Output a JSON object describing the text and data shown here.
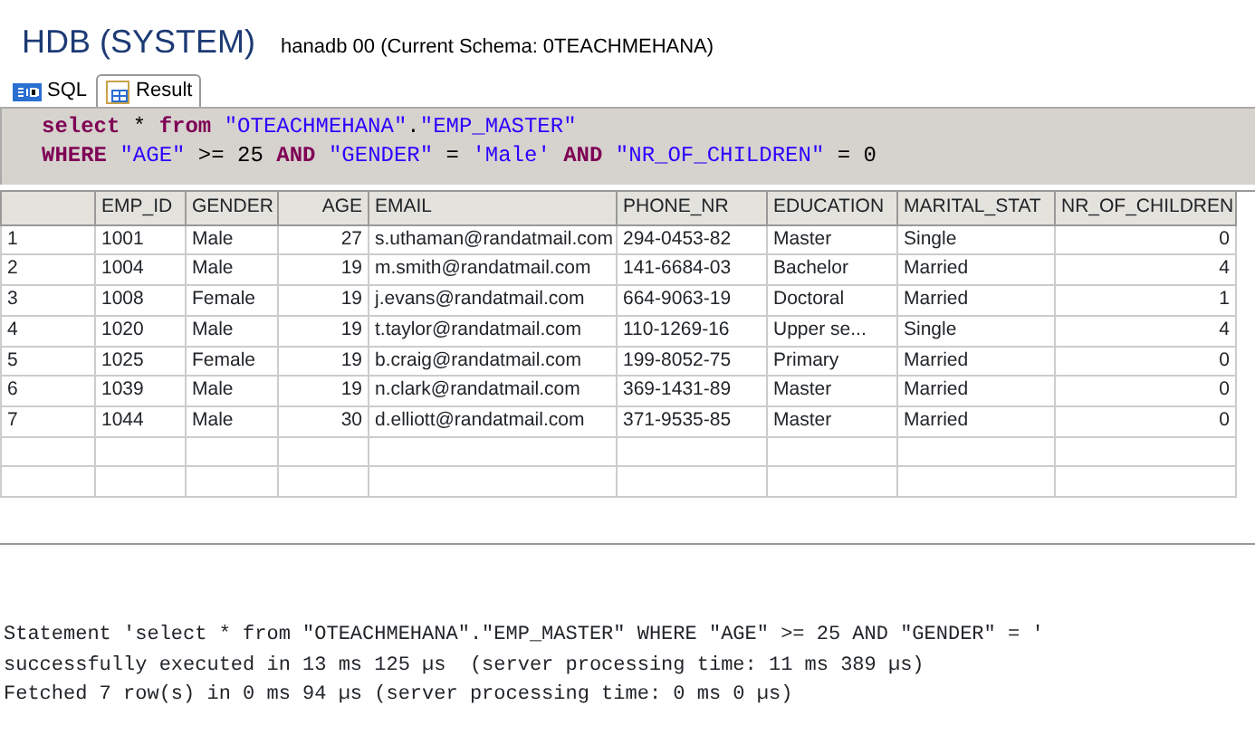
{
  "header": {
    "title": "HDB (SYSTEM)",
    "subtitle": "hanadb 00 (Current Schema: 0TEACHMEHANA)"
  },
  "tabs": [
    {
      "label": "SQL",
      "selected": false
    },
    {
      "label": "Result",
      "selected": true
    }
  ],
  "sql_lines": [
    [
      {
        "kind": "keyword",
        "text": "select"
      },
      {
        "kind": "plain",
        "text": " * "
      },
      {
        "kind": "keyword",
        "text": "from"
      },
      {
        "kind": "ident",
        "text": " \"OTEACHMEHANA\""
      },
      {
        "kind": "plain",
        "text": "."
      },
      {
        "kind": "ident",
        "text": "\"EMP_MASTER\""
      }
    ],
    [
      {
        "kind": "keyword",
        "text": "WHERE"
      },
      {
        "kind": "ident",
        "text": " \"AGE\""
      },
      {
        "kind": "plain",
        "text": " >= 25 "
      },
      {
        "kind": "keyword",
        "text": "AND"
      },
      {
        "kind": "ident",
        "text": " \"GENDER\""
      },
      {
        "kind": "plain",
        "text": " = "
      },
      {
        "kind": "ident",
        "text": "'Male' "
      },
      {
        "kind": "keyword",
        "text": "AND"
      },
      {
        "kind": "ident",
        "text": " \"NR_OF_CHILDREN\""
      },
      {
        "kind": "plain",
        "text": " = 0"
      }
    ]
  ],
  "table": {
    "columns": [
      "",
      "EMP_ID",
      "GENDER",
      "AGE",
      "EMAIL",
      "PHONE_NR",
      "EDUCATION",
      "MARITAL_STAT",
      "NR_OF_CHILDREN"
    ],
    "rows": [
      [
        "1",
        "1001",
        "Male",
        "27",
        "s.uthaman@randatmail.com",
        "294-0453-82",
        "Master",
        "Single",
        "0"
      ],
      [
        "2",
        "1004",
        "Male",
        "19",
        "m.smith@randatmail.com",
        "141-6684-03",
        "Bachelor",
        "Married",
        "4"
      ],
      [
        "3",
        "1008",
        "Female",
        "19",
        "j.evans@randatmail.com",
        "664-9063-19",
        "Doctoral",
        "Married",
        "1"
      ],
      [
        "4",
        "1020",
        "Male",
        "19",
        "t.taylor@randatmail.com",
        "110-1269-16",
        "Upper se...",
        "Single",
        "4"
      ],
      [
        "5",
        "1025",
        "Female",
        "19",
        "b.craig@randatmail.com",
        "199-8052-75",
        "Primary",
        "Married",
        "0"
      ],
      [
        "6",
        "1039",
        "Male",
        "19",
        "n.clark@randatmail.com",
        "369-1431-89",
        "Master",
        "Married",
        "0"
      ],
      [
        "7",
        "1044",
        "Male",
        "30",
        "d.elliott@randatmail.com",
        "371-9535-85",
        "Master",
        "Married",
        "0"
      ]
    ]
  },
  "log": [
    "Statement 'select * from \"OTEACHMEHANA\".\"EMP_MASTER\" WHERE \"AGE\" >= 25 AND \"GENDER\" = '",
    "successfully executed in 13 ms 125 µs  (server processing time: 11 ms 389 µs)",
    "Fetched 7 row(s) in 0 ms 94 µs (server processing time: 0 ms 0 µs)"
  ]
}
